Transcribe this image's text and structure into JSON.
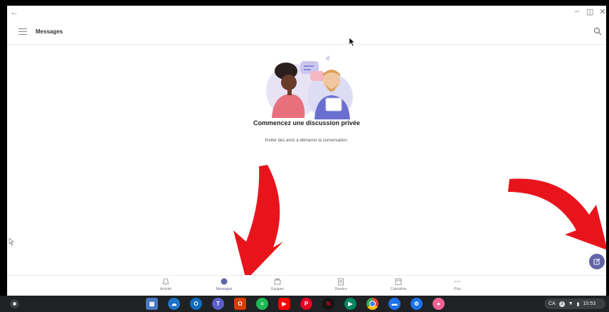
{
  "app": {
    "title": "Messages"
  },
  "empty_state": {
    "title": "Commencez une discussion privée",
    "subtitle": "Inviter des amis à démarrer la conversation."
  },
  "bottom_nav": {
    "items": [
      {
        "label": "Activité",
        "icon": "bell-icon"
      },
      {
        "label": "Messages",
        "icon": "chat-icon",
        "active": true
      },
      {
        "label": "Équipes",
        "icon": "teams-icon"
      },
      {
        "label": "Devoirs",
        "icon": "assignments-icon"
      },
      {
        "label": "Calendrier",
        "icon": "calendar-icon"
      },
      {
        "label": "Plus",
        "icon": "more-icon"
      }
    ]
  },
  "shelf": {
    "tray": {
      "lang": "CA",
      "notifications": "3",
      "time": "10:53"
    },
    "apps": [
      "files",
      "onedrive",
      "outlook",
      "teams",
      "office",
      "spotify",
      "youtube",
      "pinterest",
      "netflix",
      "play-store",
      "chrome",
      "messages",
      "settings",
      "app"
    ]
  },
  "colors": {
    "accent": "#6264a7",
    "arrow": "#e8141c",
    "shelf": "#202124"
  }
}
